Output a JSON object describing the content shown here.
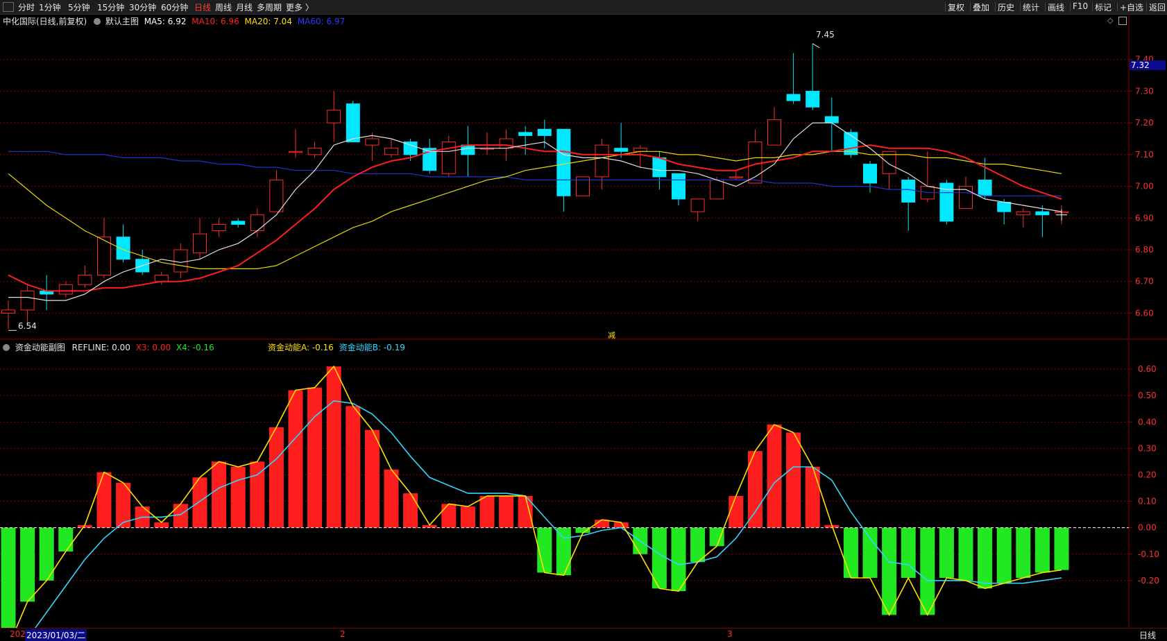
{
  "toolbar": {
    "periods": [
      "分时",
      "1分钟",
      "5分钟",
      "15分钟",
      "30分钟",
      "60分钟",
      "日线",
      "周线",
      "月线",
      "多周期",
      "更多 〉"
    ],
    "active_period": "日线",
    "right_buttons": [
      "复权",
      "叠加",
      "历史",
      "统计",
      "画线",
      "F10",
      "标记",
      "+自选",
      "返回"
    ]
  },
  "main_panel": {
    "stock": "中化国际(日线,前复权)",
    "template": "默认主图",
    "ma": [
      {
        "label": "MA5: 6.92",
        "color": "#ffffff"
      },
      {
        "label": "MA10: 6.96",
        "color": "#ff2020"
      },
      {
        "label": "MA20: 7.04",
        "color": "#ffe000"
      },
      {
        "label": "MA60: 6.97",
        "color": "#1f2fff"
      }
    ],
    "current_price_tag": "7.32",
    "high_label": "7.45",
    "low_label": "6.54",
    "center_mark": "减",
    "colors": {
      "up": "#ff2a2a",
      "down": "#00e8ff",
      "ma5": "#e0e0e0",
      "ma10": "#ff1e1e",
      "ma20": "#e8d800",
      "ma60": "#2030d0",
      "grid": "#8b0000"
    }
  },
  "sub_panel": {
    "title": "资金动能副图",
    "refline": "REFLINE: 0.00",
    "x3": "X3: 0.00",
    "x4": "X4: -0.16",
    "a": "资金动能A: -0.16",
    "b": "资金动能B: -0.19"
  },
  "bottom_bar": {
    "year_prefix": "202",
    "date": "2023/01/03/二",
    "month_2": "2",
    "month_3": "3",
    "period": "日线"
  },
  "chart_data": [
    {
      "type": "candlestick",
      "title": "",
      "ylim": [
        6.52,
        7.5
      ],
      "yticks": [
        7.4,
        7.3,
        7.2,
        7.1,
        7.0,
        6.9,
        6.8,
        6.7,
        6.6
      ],
      "ohlc": [
        [
          6.6,
          6.61,
          6.55,
          6.64
        ],
        [
          6.61,
          6.67,
          6.56,
          6.69
        ],
        [
          6.67,
          6.66,
          6.61,
          6.72
        ],
        [
          6.66,
          6.69,
          6.65,
          6.7
        ],
        [
          6.69,
          6.72,
          6.68,
          6.75
        ],
        [
          6.72,
          6.84,
          6.71,
          6.9
        ],
        [
          6.84,
          6.77,
          6.76,
          6.88
        ],
        [
          6.77,
          6.73,
          6.72,
          6.8
        ],
        [
          6.7,
          6.72,
          6.69,
          6.73
        ],
        [
          6.73,
          6.8,
          6.71,
          6.82
        ],
        [
          6.79,
          6.85,
          6.77,
          6.9
        ],
        [
          6.86,
          6.88,
          6.84,
          6.9
        ],
        [
          6.89,
          6.88,
          6.87,
          6.9
        ],
        [
          6.86,
          6.91,
          6.84,
          6.93
        ],
        [
          6.92,
          7.02,
          6.92,
          7.05
        ],
        [
          7.11,
          7.11,
          7.09,
          7.18
        ],
        [
          7.1,
          7.12,
          7.09,
          7.14
        ],
        [
          7.2,
          7.24,
          7.14,
          7.3
        ],
        [
          7.26,
          7.14,
          7.14,
          7.27
        ],
        [
          7.13,
          7.15,
          7.08,
          7.17
        ],
        [
          7.1,
          7.12,
          7.09,
          7.15
        ],
        [
          7.14,
          7.1,
          7.08,
          7.15
        ],
        [
          7.12,
          7.05,
          7.04,
          7.15
        ],
        [
          7.04,
          7.14,
          7.03,
          7.16
        ],
        [
          7.13,
          7.1,
          7.03,
          7.19
        ],
        [
          7.12,
          7.12,
          7.1,
          7.17
        ],
        [
          7.12,
          7.15,
          7.08,
          7.18
        ],
        [
          7.17,
          7.16,
          7.1,
          7.19
        ],
        [
          7.18,
          7.16,
          7.12,
          7.21
        ],
        [
          7.18,
          6.97,
          6.92,
          7.18
        ],
        [
          6.97,
          7.03,
          6.97,
          7.03
        ],
        [
          7.03,
          7.13,
          6.99,
          7.15
        ],
        [
          7.12,
          7.11,
          7.09,
          7.2
        ],
        [
          7.11,
          7.12,
          7.06,
          7.13
        ],
        [
          7.09,
          7.03,
          6.99,
          7.11
        ],
        [
          7.04,
          6.96,
          6.94,
          7.04
        ],
        [
          6.92,
          6.96,
          6.89,
          6.96
        ],
        [
          6.96,
          7.02,
          6.96,
          7.03
        ],
        [
          7.03,
          7.03,
          7.02,
          7.05
        ],
        [
          7.01,
          7.14,
          7.01,
          7.18
        ],
        [
          7.13,
          7.21,
          7.13,
          7.25
        ],
        [
          7.29,
          7.27,
          7.26,
          7.42
        ],
        [
          7.3,
          7.25,
          7.24,
          7.45
        ],
        [
          7.22,
          7.2,
          7.11,
          7.28
        ],
        [
          7.17,
          7.1,
          7.09,
          7.18
        ],
        [
          7.07,
          7.01,
          6.98,
          7.08
        ],
        [
          7.04,
          7.11,
          6.99,
          7.11
        ],
        [
          7.02,
          6.95,
          6.86,
          7.03
        ],
        [
          6.96,
          7.0,
          6.95,
          7.11
        ],
        [
          7.01,
          6.89,
          6.88,
          7.02
        ],
        [
          6.93,
          7.0,
          6.93,
          7.03
        ],
        [
          7.02,
          6.97,
          6.96,
          7.09
        ],
        [
          6.95,
          6.92,
          6.88,
          6.96
        ],
        [
          6.91,
          6.92,
          6.87,
          6.93
        ],
        [
          6.92,
          6.91,
          6.84,
          6.94
        ],
        [
          6.92,
          6.92,
          6.88,
          6.94
        ]
      ],
      "ma5": [
        6.65,
        6.65,
        6.64,
        6.64,
        6.66,
        6.7,
        6.73,
        6.75,
        6.77,
        6.76,
        6.77,
        6.8,
        6.82,
        6.86,
        6.91,
        6.99,
        7.05,
        7.13,
        7.15,
        7.16,
        7.15,
        7.13,
        7.11,
        7.11,
        7.12,
        7.12,
        7.12,
        7.13,
        7.14,
        7.1,
        7.09,
        7.09,
        7.08,
        7.06,
        7.05,
        7.05,
        7.04,
        7.02,
        7.0,
        7.03,
        7.07,
        7.15,
        7.2,
        7.2,
        7.16,
        7.12,
        7.07,
        7.04,
        7.0,
        6.99,
        6.99,
        6.96,
        6.95,
        6.94,
        6.93,
        6.92
      ],
      "ma10": [
        6.72,
        6.69,
        6.67,
        6.67,
        6.67,
        6.68,
        6.68,
        6.69,
        6.7,
        6.7,
        6.71,
        6.73,
        6.75,
        6.79,
        6.83,
        6.88,
        6.93,
        6.99,
        7.03,
        7.06,
        7.08,
        7.09,
        7.11,
        7.12,
        7.13,
        7.13,
        7.13,
        7.12,
        7.11,
        7.11,
        7.1,
        7.1,
        7.1,
        7.1,
        7.09,
        7.07,
        7.06,
        7.05,
        7.05,
        7.07,
        7.08,
        7.09,
        7.11,
        7.11,
        7.12,
        7.13,
        7.12,
        7.12,
        7.12,
        7.11,
        7.09,
        7.06,
        7.03,
        7.0,
        6.98,
        6.96
      ],
      "ma20": [
        7.04,
        6.99,
        6.94,
        6.9,
        6.86,
        6.83,
        6.8,
        6.78,
        6.76,
        6.75,
        6.74,
        6.74,
        6.74,
        6.74,
        6.75,
        6.78,
        6.81,
        6.84,
        6.87,
        6.89,
        6.92,
        6.94,
        6.96,
        6.98,
        7.0,
        7.02,
        7.03,
        7.05,
        7.06,
        7.07,
        7.08,
        7.09,
        7.1,
        7.11,
        7.11,
        7.1,
        7.1,
        7.09,
        7.08,
        7.09,
        7.09,
        7.1,
        7.1,
        7.11,
        7.11,
        7.1,
        7.1,
        7.1,
        7.09,
        7.09,
        7.08,
        7.07,
        7.07,
        7.06,
        7.05,
        7.04
      ],
      "ma60": [
        7.11,
        7.11,
        7.11,
        7.1,
        7.1,
        7.1,
        7.09,
        7.09,
        7.09,
        7.08,
        7.08,
        7.07,
        7.07,
        7.06,
        7.06,
        7.05,
        7.05,
        7.05,
        7.04,
        7.04,
        7.04,
        7.04,
        7.03,
        7.03,
        7.03,
        7.03,
        7.03,
        7.02,
        7.02,
        7.02,
        7.02,
        7.02,
        7.02,
        7.02,
        7.02,
        7.02,
        7.02,
        7.02,
        7.02,
        7.02,
        7.01,
        7.01,
        7.01,
        7.0,
        7.0,
        7.0,
        6.99,
        6.99,
        6.98,
        6.98,
        6.98,
        6.97,
        6.97,
        6.97,
        6.97,
        6.97
      ]
    },
    {
      "type": "bar",
      "title": "资金动能副图",
      "ylim": [
        -0.35,
        0.65
      ],
      "yticks": [
        0.6,
        0.5,
        0.4,
        0.3,
        0.2,
        0.1,
        0.0,
        -0.1,
        -0.2
      ],
      "bars": [
        -0.45,
        -0.28,
        -0.2,
        -0.09,
        0.01,
        0.21,
        0.17,
        0.08,
        0.02,
        0.09,
        0.19,
        0.25,
        0.23,
        0.25,
        0.38,
        0.52,
        0.53,
        0.61,
        0.46,
        0.37,
        0.22,
        0.13,
        0.01,
        0.09,
        0.08,
        0.12,
        0.12,
        0.12,
        -0.17,
        -0.18,
        -0.02,
        0.03,
        0.02,
        -0.1,
        -0.23,
        -0.24,
        -0.13,
        -0.07,
        0.12,
        0.29,
        0.39,
        0.36,
        0.23,
        0.01,
        -0.19,
        -0.19,
        -0.33,
        -0.19,
        -0.33,
        -0.19,
        -0.2,
        -0.23,
        -0.21,
        -0.19,
        -0.17,
        -0.16
      ],
      "series_a": [
        -0.45,
        -0.28,
        -0.2,
        -0.09,
        0.01,
        0.21,
        0.17,
        0.08,
        0.02,
        0.09,
        0.19,
        0.25,
        0.23,
        0.25,
        0.38,
        0.52,
        0.53,
        0.61,
        0.46,
        0.37,
        0.22,
        0.13,
        0.01,
        0.09,
        0.08,
        0.12,
        0.12,
        0.12,
        -0.17,
        -0.18,
        -0.02,
        0.03,
        0.02,
        -0.1,
        -0.23,
        -0.24,
        -0.13,
        -0.07,
        0.12,
        0.29,
        0.39,
        0.36,
        0.23,
        0.01,
        -0.19,
        -0.19,
        -0.33,
        -0.19,
        -0.33,
        -0.19,
        -0.2,
        -0.23,
        -0.21,
        -0.19,
        -0.17,
        -0.16
      ],
      "series_b": [
        -0.53,
        -0.42,
        -0.32,
        -0.22,
        -0.12,
        -0.04,
        0.02,
        0.04,
        0.04,
        0.05,
        0.1,
        0.15,
        0.18,
        0.2,
        0.26,
        0.34,
        0.42,
        0.48,
        0.47,
        0.43,
        0.36,
        0.27,
        0.19,
        0.16,
        0.13,
        0.13,
        0.13,
        0.12,
        0.04,
        -0.04,
        -0.03,
        -0.01,
        0.0,
        -0.05,
        -0.1,
        -0.14,
        -0.13,
        -0.11,
        -0.04,
        0.06,
        0.17,
        0.23,
        0.23,
        0.18,
        0.06,
        -0.04,
        -0.13,
        -0.14,
        -0.2,
        -0.2,
        -0.2,
        -0.21,
        -0.21,
        -0.21,
        -0.2,
        -0.19
      ]
    }
  ]
}
